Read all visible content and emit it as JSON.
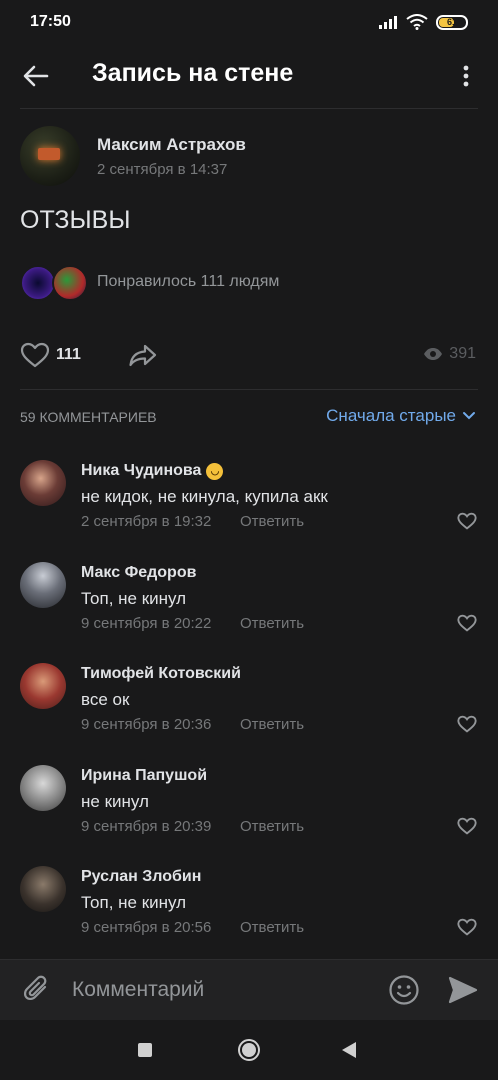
{
  "status_bar": {
    "time": "17:50",
    "battery": "61",
    "battery_level": 0.61,
    "icons": [
      "signal-icon",
      "wifi-icon",
      "battery-icon"
    ]
  },
  "header": {
    "title": "Запись на стене",
    "back_icon": "arrow-left-icon",
    "menu_icon": "more-vertical-icon"
  },
  "post": {
    "author": "Максим Астрахов",
    "date": "2 сентября в 14:37",
    "text": "ОТЗЫВЫ",
    "likes_summary": "Понравилось 111 людям",
    "like_count": "111",
    "views": "391"
  },
  "comments_section": {
    "count_label": "59 КОММЕНТАРИЕВ",
    "sort_label": "Сначала старые",
    "reply_label": "Ответить",
    "items": [
      {
        "author": "Ника Чудинова",
        "text": "не кидок, не кинула, купила акк",
        "date": "2 сентября в 19:32",
        "has_emoji": true
      },
      {
        "author": "Макс Федоров",
        "text": "Топ, не кинул",
        "date": "9 сентября в 20:22"
      },
      {
        "author": "Тимофей Котовский",
        "text": "все ок",
        "date": "9 сентября в 20:36"
      },
      {
        "author": "Ирина Папушой",
        "text": "не кинул",
        "date": "9 сентября в 20:39"
      },
      {
        "author": "Руслан Злобин",
        "text": "Топ, не кинул",
        "date": "9 сентября в 20:56"
      }
    ]
  },
  "composer": {
    "placeholder": "Комментарий"
  },
  "colors": {
    "background": "#19191a",
    "accent": "#71aaeb",
    "text_primary": "#e1e3e6",
    "text_secondary": "#76787a"
  }
}
